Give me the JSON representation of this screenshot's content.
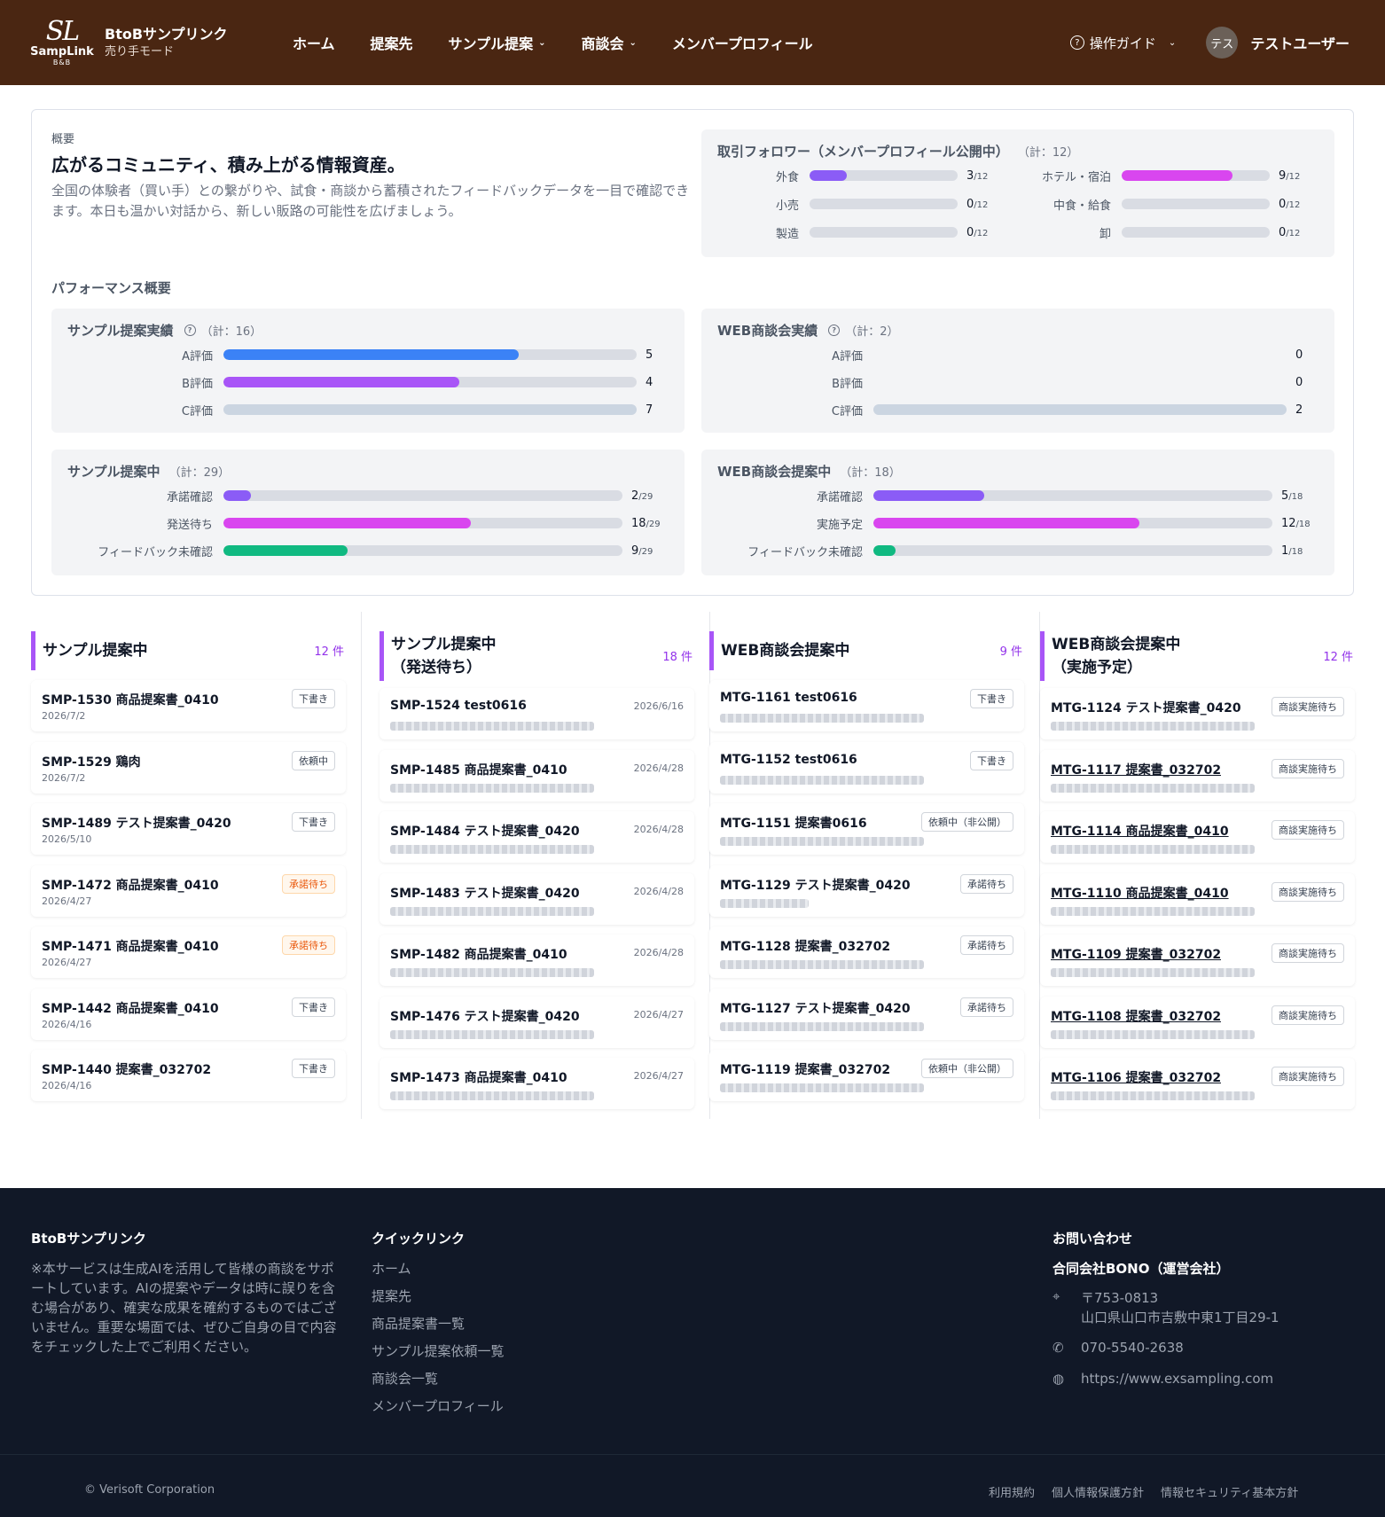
{
  "header": {
    "logo": {
      "mark": "SL",
      "name": "SampLink",
      "sub": "B&B"
    },
    "brand_name": "BtoBサンプリンク",
    "mode": "売り手モード",
    "nav": [
      {
        "label": "ホーム",
        "dropdown": false
      },
      {
        "label": "提案先",
        "dropdown": false
      },
      {
        "label": "サンプル提案",
        "dropdown": true
      },
      {
        "label": "商談会",
        "dropdown": true
      },
      {
        "label": "メンバープロフィール",
        "dropdown": false
      }
    ],
    "guide": "操作ガイド",
    "avatar": "テス",
    "user": "テストユーザー"
  },
  "overview": {
    "tag": "概要",
    "title": "広がるコミュニティ、積み上がる情報資産。",
    "description": "全国の体験者（買い手）との繋がりや、試食・商談から蓄積されたフィードバックデータを一目で確認できます。本日も温かい対話から、新しい販路の可能性を広げましょう。",
    "followers": {
      "title": "取引フォロワー（メンバープロフィール公開中）",
      "total": "（計：12）",
      "items": [
        {
          "label": "外食",
          "value": 3,
          "max": 12,
          "color": "#8b5cf6"
        },
        {
          "label": "ホテル・宿泊",
          "value": 9,
          "max": 12,
          "color": "#d946ef"
        },
        {
          "label": "小売",
          "value": 0,
          "max": 12,
          "color": "#8b5cf6"
        },
        {
          "label": "中食・給食",
          "value": 0,
          "max": 12,
          "color": "#d946ef"
        },
        {
          "label": "製造",
          "value": 0,
          "max": 12,
          "color": "#8b5cf6"
        },
        {
          "label": "卸",
          "value": 0,
          "max": 12,
          "color": "#d946ef"
        }
      ]
    },
    "perf_title": "パフォーマンス概要",
    "sample_results": {
      "title": "サンプル提案実績",
      "total": "（計：16）",
      "rows": [
        {
          "label": "A評価",
          "value": 5,
          "max": 7,
          "color": "#3b82f6"
        },
        {
          "label": "B評価",
          "value": 4,
          "max": 7,
          "color": "#a855f7"
        },
        {
          "label": "C評価",
          "value": 7,
          "max": 7,
          "color": "#cbd5e1"
        }
      ]
    },
    "web_results": {
      "title": "WEB商談会実績",
      "total": "（計：2）",
      "rows": [
        {
          "label": "A評価",
          "value": 0,
          "max": 2,
          "color": "#3b82f6"
        },
        {
          "label": "B評価",
          "value": 0,
          "max": 2,
          "color": "#a855f7"
        },
        {
          "label": "C評価",
          "value": 2,
          "max": 2,
          "color": "#cbd5e1"
        }
      ]
    },
    "sample_pending": {
      "title": "サンプル提案中",
      "total": "（計：29）",
      "rows": [
        {
          "label": "承諾確認",
          "value": 2,
          "max": 29,
          "color": "#8b5cf6"
        },
        {
          "label": "発送待ち",
          "value": 18,
          "max": 29,
          "color": "#d946ef"
        },
        {
          "label": "フィードバック未確認",
          "value": 9,
          "max": 29,
          "color": "#10b981"
        }
      ]
    },
    "web_pending": {
      "title": "WEB商談会提案中",
      "total": "（計：18）",
      "rows": [
        {
          "label": "承諾確認",
          "value": 5,
          "max": 18,
          "color": "#8b5cf6"
        },
        {
          "label": "実施予定",
          "value": 12,
          "max": 18,
          "color": "#d946ef"
        },
        {
          "label": "フィードバック未確認",
          "value": 1,
          "max": 18,
          "color": "#10b981"
        }
      ]
    }
  },
  "columns": [
    {
      "title": [
        "サンプル提案中"
      ],
      "count": "12 件",
      "cards": [
        {
          "title": "SMP-1530 商品提案書_0410",
          "sub": "2026/7/2",
          "badge": "下書き"
        },
        {
          "title": "SMP-1529 鶏肉",
          "sub": "2026/7/2",
          "badge": "依頼中"
        },
        {
          "title": "SMP-1489 テスト提案書_0420",
          "sub": "2026/5/10",
          "badge": "下書き"
        },
        {
          "title": "SMP-1472 商品提案書_0410",
          "sub": "2026/4/27",
          "badge": "承諾待ち",
          "orange": true
        },
        {
          "title": "SMP-1471 商品提案書_0410",
          "sub": "2026/4/27",
          "badge": "承諾待ち",
          "orange": true
        },
        {
          "title": "SMP-1442 商品提案書_0410",
          "sub": "2026/4/16",
          "badge": "下書き"
        },
        {
          "title": "SMP-1440 提案書_032702",
          "sub": "2026/4/16",
          "badge": "下書き"
        }
      ]
    },
    {
      "title": [
        "サンプル提案中",
        "（発送待ち）"
      ],
      "count": "18 件",
      "cards": [
        {
          "title": "SMP-1524 test0616",
          "date": "2026/6/16"
        },
        {
          "title": "SMP-1485 商品提案書_0410",
          "date": "2026/4/28"
        },
        {
          "title": "SMP-1484 テスト提案書_0420",
          "date": "2026/4/28"
        },
        {
          "title": "SMP-1483 テスト提案書_0420",
          "date": "2026/4/28"
        },
        {
          "title": "SMP-1482 商品提案書_0410",
          "date": "2026/4/28"
        },
        {
          "title": "SMP-1476 テスト提案書_0420",
          "date": "2026/4/27"
        },
        {
          "title": "SMP-1473 商品提案書_0410",
          "date": "2026/4/27"
        }
      ]
    },
    {
      "title": [
        "WEB商談会提案中"
      ],
      "count": "9 件",
      "cards": [
        {
          "title": "MTG-1161 test0616",
          "badge": "下書き"
        },
        {
          "title": "MTG-1152 test0616",
          "badge": "下書き"
        },
        {
          "title": "MTG-1151 提案書0616",
          "badge": "依頼中（非公開）"
        },
        {
          "title": "MTG-1129 テスト提案書_0420",
          "badge": "承諾待ち"
        },
        {
          "title": "MTG-1128 提案書_032702",
          "badge": "承諾待ち"
        },
        {
          "title": "MTG-1127 テスト提案書_0420",
          "badge": "承諾待ち"
        },
        {
          "title": "MTG-1119 提案書_032702",
          "badge": "依頼中（非公開）"
        }
      ]
    },
    {
      "title": [
        "WEB商談会提案中",
        "（実施予定）"
      ],
      "count": "12 件",
      "cards": [
        {
          "title": "MTG-1124 テスト提案書_0420",
          "badge": "商談実施待ち"
        },
        {
          "title": "MTG-1117 提案書_032702",
          "badge": "商談実施待ち",
          "link": true
        },
        {
          "title": "MTG-1114 商品提案書_0410",
          "badge": "商談実施待ち",
          "link": true
        },
        {
          "title": "MTG-1110 商品提案書_0410",
          "badge": "商談実施待ち",
          "link": true
        },
        {
          "title": "MTG-1109 提案書_032702",
          "badge": "商談実施待ち",
          "link": true
        },
        {
          "title": "MTG-1108 提案書_032702",
          "badge": "商談実施待ち",
          "link": true
        },
        {
          "title": "MTG-1106 提案書_032702",
          "badge": "商談実施待ち",
          "link": true
        }
      ]
    }
  ],
  "footer": {
    "brand": "BtoBサンプリンク",
    "note": "※本サービスは生成AIを活用して皆様の商談をサポートしています。AIの提案やデータは時に誤りを含む場合があり、確実な成果を確約するものではございません。重要な場面では、ぜひご自身の目で内容をチェックした上でご利用ください。",
    "quick_title": "クイックリンク",
    "quick_links": [
      "ホーム",
      "提案先",
      "商品提案書一覧",
      "サンプル提案依頼一覧",
      "商談会一覧",
      "メンバープロフィール"
    ],
    "contact_title": "お問い合わせ",
    "company": "合同会社BONO（運営会社）",
    "postal": "〒753-0813",
    "address": "山口県山口市吉敷中東1丁目29-1",
    "phone": "070-5540-2638",
    "url": "https://www.exsampling.com",
    "copyright": "© Verisoft Corporation",
    "legal": [
      "利用規約",
      "個人情報保護方針",
      "情報セキュリティ基本方針"
    ]
  }
}
